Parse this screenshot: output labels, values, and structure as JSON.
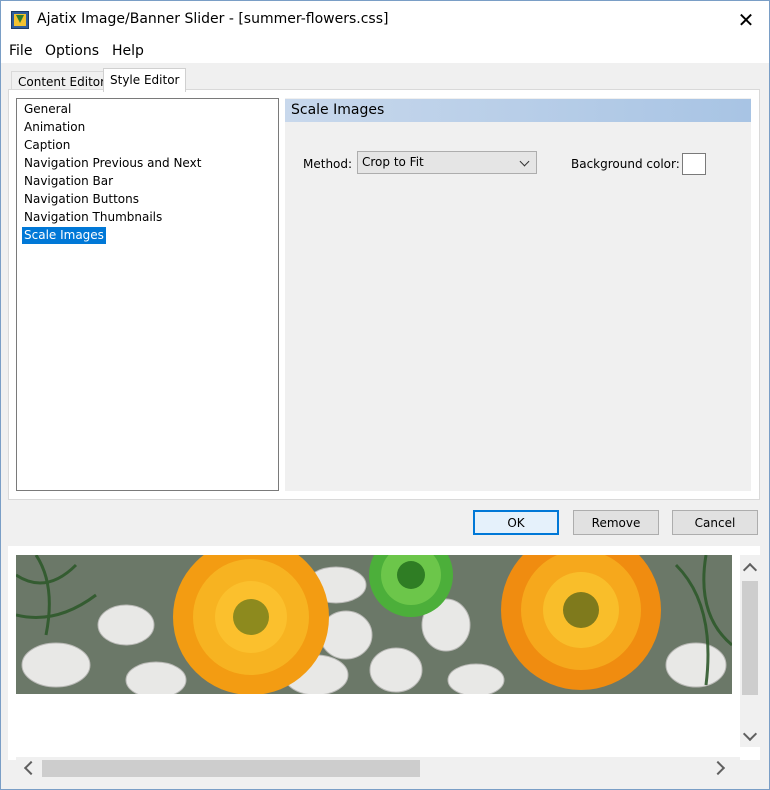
{
  "window": {
    "title": "Ajatix Image/Banner Slider - [summer-flowers.css]",
    "close_glyph": "✕"
  },
  "menu": [
    "File",
    "Options",
    "Help"
  ],
  "tabs": [
    {
      "label": "Content Editor",
      "active": false
    },
    {
      "label": "Style Editor",
      "active": true
    }
  ],
  "categories": [
    "General",
    "Animation",
    "Caption",
    "Navigation Previous and Next",
    "Navigation Bar",
    "Navigation Buttons",
    "Navigation Thumbnails",
    "Scale Images"
  ],
  "selected_category": "Scale Images",
  "section": {
    "title": "Scale Images",
    "method_label": "Method:",
    "method_value": "Crop to Fit",
    "background_color_label": "Background color:",
    "background_color": "#ffffff"
  },
  "buttons": {
    "ok": "OK",
    "remove": "Remove",
    "cancel": "Cancel"
  },
  "colors": {
    "selection": "#0078d7",
    "section_header": "#b3cbe8"
  },
  "icons": {
    "app": "app-logo-icon",
    "close": "close-icon",
    "dropdown": "chevron-down-icon",
    "scroll_up": "chevron-up-icon",
    "scroll_down": "chevron-down-icon",
    "scroll_left": "chevron-left-icon",
    "scroll_right": "chevron-right-icon"
  }
}
